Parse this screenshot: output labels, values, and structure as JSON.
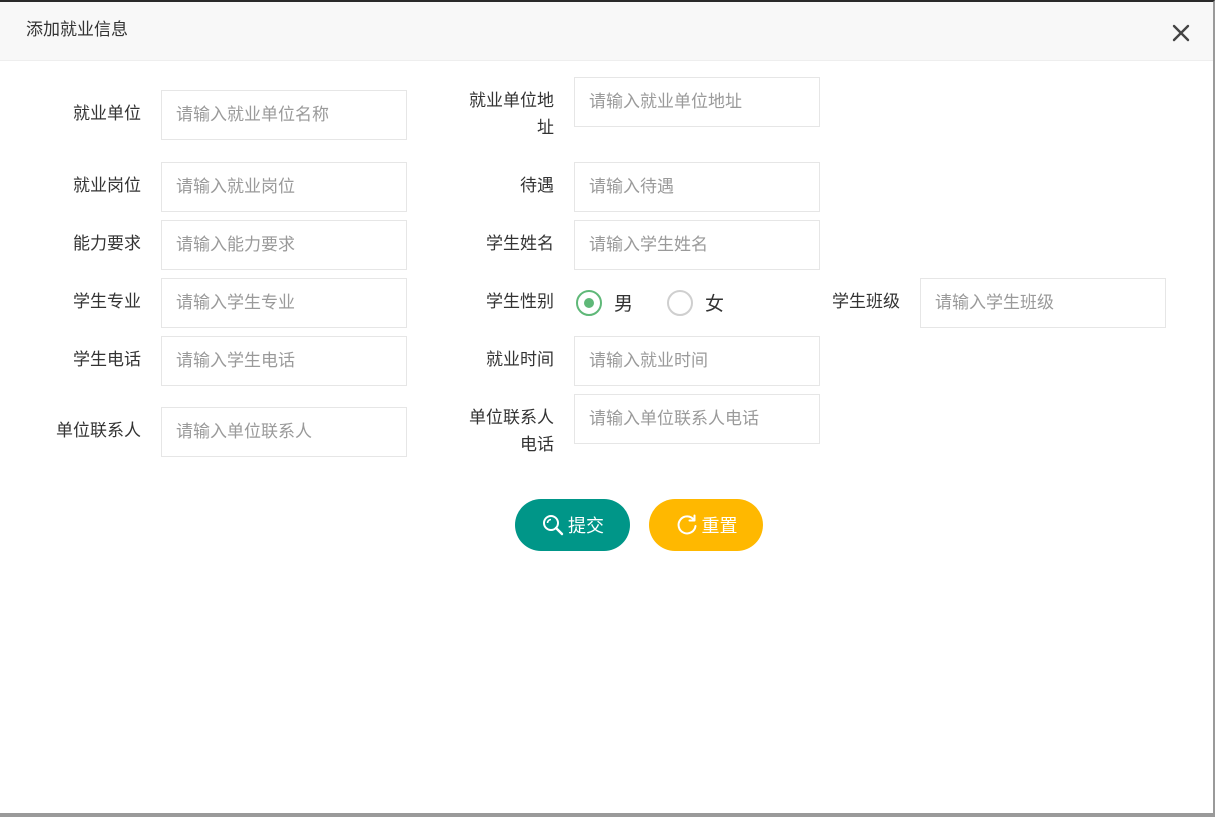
{
  "dialog": {
    "title": "添加就业信息"
  },
  "fields": {
    "company": {
      "label": "就业单位",
      "placeholder": "请输入就业单位名称"
    },
    "company_address": {
      "label_line1": "就业单位地",
      "label_line2": "址",
      "placeholder": "请输入就业单位地址"
    },
    "position": {
      "label": "就业岗位",
      "placeholder": "请输入就业岗位"
    },
    "salary": {
      "label": "待遇",
      "placeholder": "请输入待遇"
    },
    "requirements": {
      "label": "能力要求",
      "placeholder": "请输入能力要求"
    },
    "student_name": {
      "label": "学生姓名",
      "placeholder": "请输入学生姓名"
    },
    "major": {
      "label": "学生专业",
      "placeholder": "请输入学生专业"
    },
    "gender": {
      "label": "学生性别",
      "options": [
        "男",
        "女"
      ],
      "selected": "男"
    },
    "class": {
      "label": "学生班级",
      "placeholder": "请输入学生班级"
    },
    "phone": {
      "label": "学生电话",
      "placeholder": "请输入学生电话"
    },
    "employ_time": {
      "label": "就业时间",
      "placeholder": "请输入就业时间"
    },
    "contact": {
      "label": "单位联系人",
      "placeholder": "请输入单位联系人"
    },
    "contact_phone": {
      "label_line1": "单位联系人",
      "label_line2": "电话",
      "placeholder": "请输入单位联系人电话"
    }
  },
  "buttons": {
    "submit": "提交",
    "reset": "重置"
  },
  "colors": {
    "submit_bg": "#009688",
    "reset_bg": "#ffb800",
    "radio_checked": "#5fb878"
  },
  "icons": {
    "close": "close-icon",
    "submit": "search-icon",
    "reset": "refresh-icon"
  }
}
